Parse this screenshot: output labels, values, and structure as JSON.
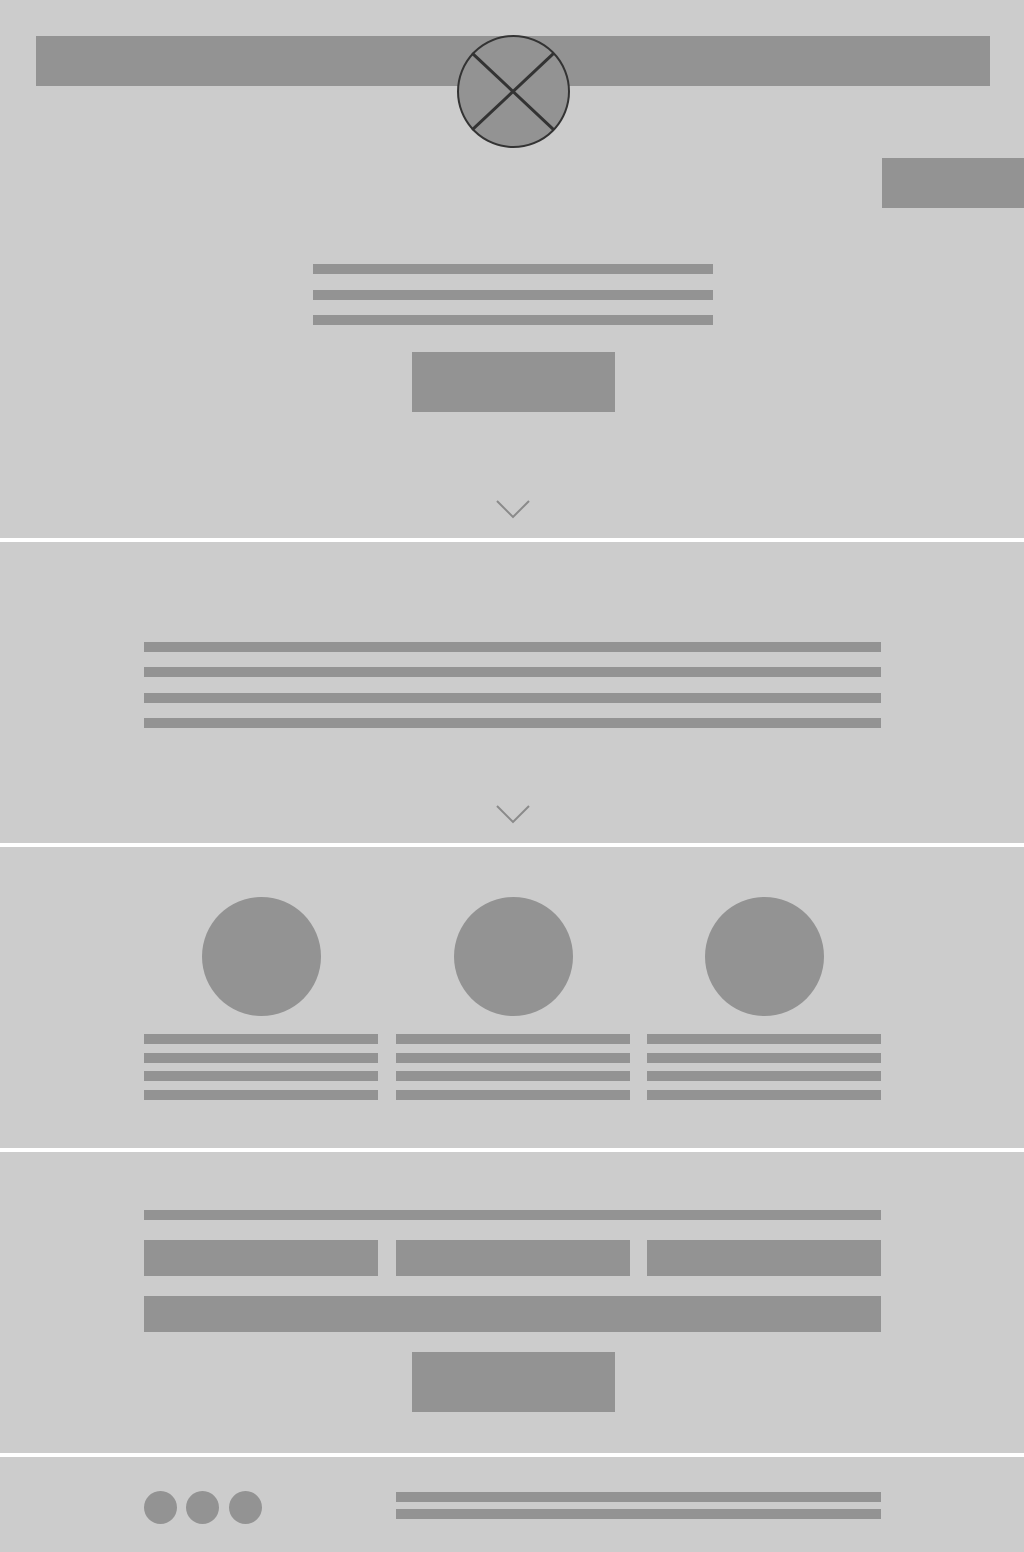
{
  "theme": {
    "background": "#cccccc",
    "placeholder": "#939393",
    "separator": "#ffffff",
    "logo_stroke": "#333333"
  },
  "header": {
    "logo_icon": "image-placeholder-icon",
    "cta_icon": "button-placeholder"
  },
  "hero": {
    "text_lines": 3,
    "scroll_icon": "chevron-down-icon"
  },
  "about": {
    "text_lines": 4,
    "scroll_icon": "chevron-down-icon"
  },
  "features": {
    "items": 3,
    "lines_per_item": 4
  },
  "signup": {
    "fields_row": 3,
    "submit_icon": "button-placeholder"
  },
  "footer": {
    "social_icons": [
      "social-icon",
      "social-icon",
      "social-icon"
    ],
    "text_lines": 2
  }
}
